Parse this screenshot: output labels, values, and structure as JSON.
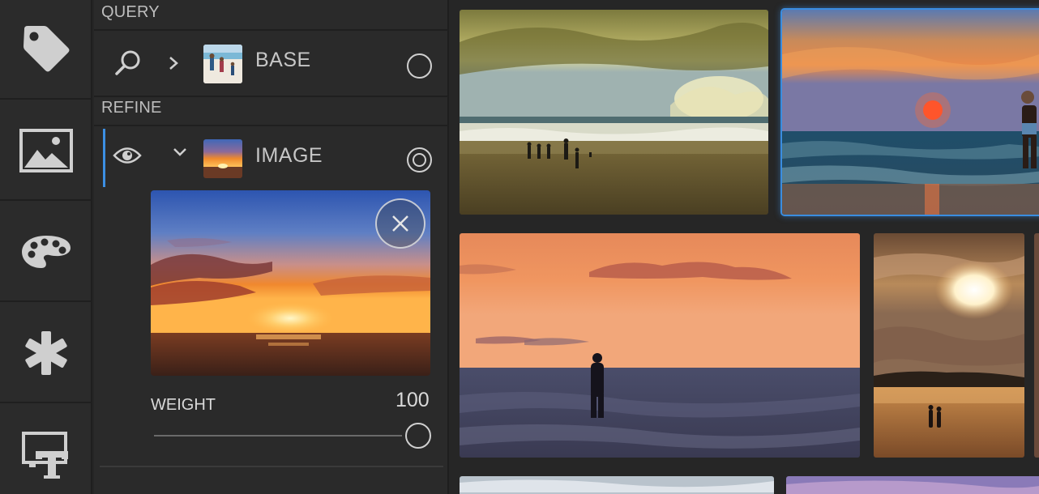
{
  "rail": {
    "items": [
      {
        "icon": "tag-icon"
      },
      {
        "icon": "image-icon"
      },
      {
        "icon": "palette-icon"
      },
      {
        "icon": "asterisk-icon"
      },
      {
        "icon": "text-screen-icon"
      }
    ]
  },
  "query_panel": {
    "query_section_label": "QUERY",
    "base_row": {
      "title": "BASE",
      "expand_icon": "chevron-right-icon",
      "search_icon": "search-icon",
      "selected": false
    },
    "refine_section_label": "REFINE",
    "image_row": {
      "title": "IMAGE",
      "expand_icon": "chevron-down-icon",
      "visibility_icon": "eye-icon",
      "selected": true
    },
    "weight": {
      "label": "WEIGHT",
      "value": "100",
      "slider_fraction": 1.0
    }
  },
  "colors": {
    "accent": "#3c8fe3",
    "panel_bg": "#2a2a2a",
    "rail_bg": "#2b2b2b"
  }
}
